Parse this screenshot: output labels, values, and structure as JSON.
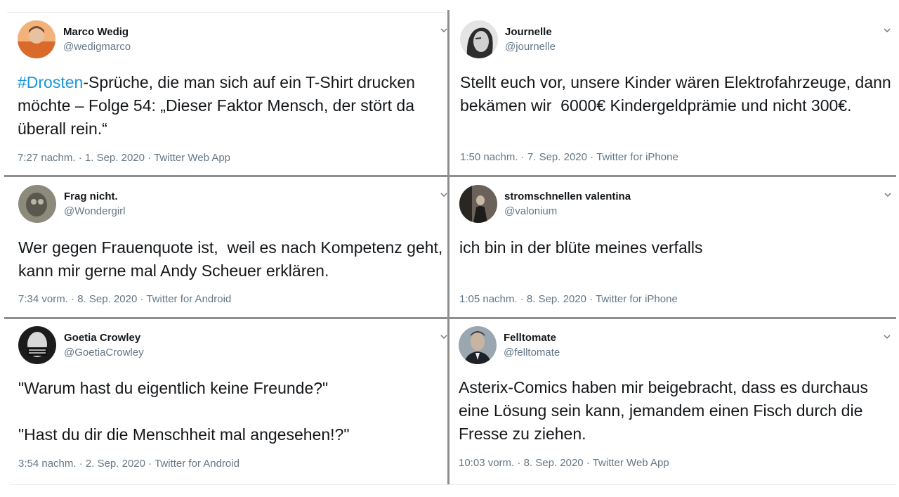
{
  "tweets": [
    {
      "name": "Marco Wedig",
      "handle": "@wedigmarco",
      "hashtag": "#Drosten",
      "text": "-Sprüche, die man sich auf ein T-Shirt drucken möchte – Folge 54: „Dieser Faktor Mensch, der stört da überall rein.“",
      "time": "7:27 nachm.",
      "date": "1. Sep. 2020",
      "source": "Twitter Web App",
      "avatar_icon": "avatar-photo-orange",
      "avatar_color": "#d96a2a"
    },
    {
      "name": "Journelle",
      "handle": "@journelle",
      "text": "Stellt euch vor, unsere Kinder wären Elektrofahrzeuge, dann bekämen wir  6000€ Kindergeldprämie und nicht 300€.",
      "time": "1:50 nachm.",
      "date": "7. Sep. 2020",
      "source": "Twitter for iPhone",
      "avatar_icon": "avatar-photo-bw",
      "avatar_color": "#9a9a9a"
    },
    {
      "name": "Frag nicht.",
      "handle": "@Wondergirl",
      "text": "Wer gegen Frauenquote ist,  weil es nach Kompetenz geht, kann mir gerne mal Andy Scheuer erklären.",
      "time": "7:34 vorm.",
      "date": "8. Sep. 2020",
      "source": "Twitter for Android",
      "avatar_icon": "avatar-photo-gray",
      "avatar_color": "#6e6e64"
    },
    {
      "name": "stromschnellen valentina",
      "handle": "@valonium",
      "text": "ich bin in der blüte meines verfalls",
      "time": "1:05 nachm.",
      "date": "8. Sep. 2020",
      "source": "Twitter for iPhone",
      "avatar_icon": "avatar-photo-dark",
      "avatar_color": "#3b3632"
    },
    {
      "name": "Goetia Crowley",
      "handle": "@GoetiaCrowley",
      "text": "\"Warum hast du eigentlich keine Freunde?\"\n\n\"Hast du dir die Menschheit mal angesehen!?\"",
      "time": "3:54 nachm.",
      "date": "2. Sep. 2020",
      "source": "Twitter for Android",
      "avatar_icon": "avatar-photo-mask",
      "avatar_color": "#2a2a2a"
    },
    {
      "name": "Felltomate",
      "handle": "@felltomate",
      "text": "Asterix-Comics haben mir beigebracht, dass es durchaus eine Lösung sein kann, jemandem einen Fisch durch die Fresse zu ziehen.",
      "time": "10:03 vorm.",
      "date": "8. Sep. 2020",
      "source": "Twitter Web App",
      "avatar_icon": "avatar-photo-portrait",
      "avatar_color": "#5a6470"
    }
  ],
  "separator": "·",
  "colors": {
    "text": "#14171a",
    "secondary": "#657786",
    "link": "#1b95e0",
    "divider": "#8e8e8e"
  }
}
